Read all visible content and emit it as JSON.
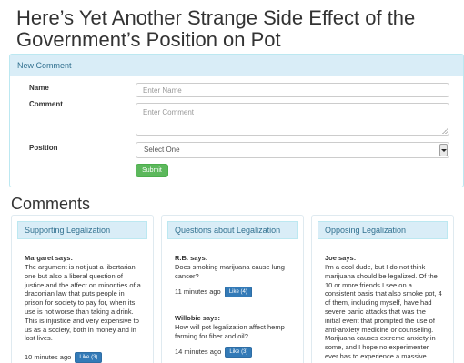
{
  "page": {
    "title": "Here’s Yet Another Strange Side Effect of the Government’s Position on Pot"
  },
  "form": {
    "heading": "New Comment",
    "name_label": "Name",
    "name_placeholder": "Enter Name",
    "comment_label": "Comment",
    "comment_placeholder": "Enter Comment",
    "position_label": "Position",
    "position_selected": "Select One",
    "submit_label": "Submit"
  },
  "comments_section": {
    "title": "Comments",
    "columns": [
      {
        "heading": "Supporting Legalization",
        "comments": [
          {
            "author": "Margaret says:",
            "text": "The argument is not just a libertarian one but also a liberal question of justice and the affect on minorities of a draconian law that puts people in prison for society to pay for, when its use is not worse than taking a drink. This is injustice and very expensive to us as a society, both in money and in lost lives.",
            "time": "10 minutes ago",
            "like": "Like (3)"
          }
        ]
      },
      {
        "heading": "Questions about Legalization",
        "comments": [
          {
            "author": "R.B. says:",
            "text": "Does smoking marijuana cause lung cancer?",
            "time": "11 minutes ago",
            "like": "Like (4)"
          },
          {
            "author": "Willobie says:",
            "text": "How will pot legalization affect hemp farming for fiber and oil?",
            "time": "14 minutes ago",
            "like": "Like (3)"
          }
        ]
      },
      {
        "heading": "Opposing Legalization",
        "comments": [
          {
            "author": "Joe says:",
            "text": "I'm a cool dude, but I do not think marijuana should be legalized. Of the 10 or more friends I see on a consistent basis that also smoke pot, 4 of them, including myself, have had severe panic attacks that was the initial event that prompted the use of anti-anxiety medicine or counseling. Marijuana causes extreme anxiety in some, and I hope no experimenter ever has to experience a massive"
          }
        ]
      }
    ]
  }
}
